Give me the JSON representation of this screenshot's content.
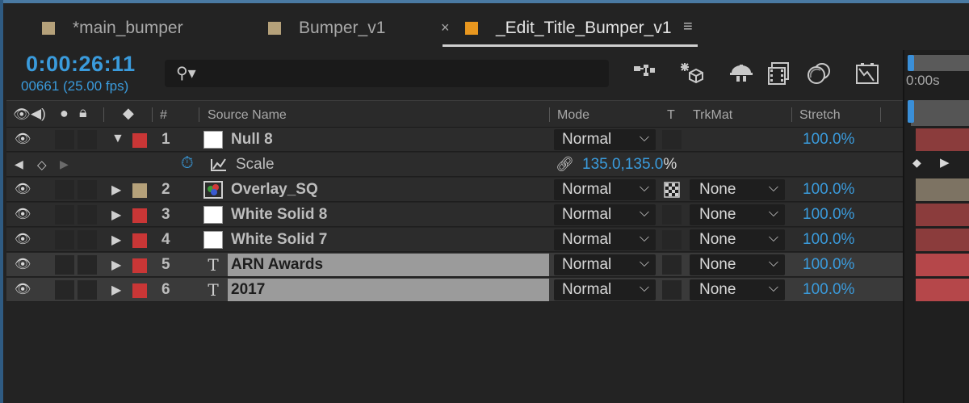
{
  "tabs": [
    {
      "label": "*main_bumper",
      "color": "#b5a17a",
      "active": false
    },
    {
      "label": "Bumper_v1",
      "color": "#b5a17a",
      "active": false
    },
    {
      "label": "_Edit_Title_Bumper_v1",
      "color": "#e8971f",
      "active": true
    }
  ],
  "header": {
    "timecode": "0:00:26:11",
    "frames": "00661 (25.00 fps)",
    "search_value": "",
    "search_placeholder": ""
  },
  "columns": {
    "number": "#",
    "source_name": "Source Name",
    "mode": "Mode",
    "t": "T",
    "trkmat": "TrkMat",
    "stretch": "Stretch"
  },
  "timeline": {
    "ruler_label": "0:00s"
  },
  "layers": [
    {
      "num": "1",
      "name": "Null 8",
      "label_color": "#c93636",
      "source": "white",
      "expanded": true,
      "mode": "Normal",
      "trkmat": "",
      "stretch": "100.0%",
      "selected": false,
      "bar_color": "#8b3c3c"
    },
    {
      "num": "2",
      "name": "Overlay_SQ",
      "label_color": "#b5a17a",
      "source": "footage",
      "expanded": false,
      "mode": "Normal",
      "trkmat": "None",
      "stretch": "100.0%",
      "selected": false,
      "bar_color": "#7d7363"
    },
    {
      "num": "3",
      "name": "White Solid 8",
      "label_color": "#c93636",
      "source": "white",
      "expanded": false,
      "mode": "Normal",
      "trkmat": "None",
      "stretch": "100.0%",
      "selected": false,
      "bar_color": "#8b3c3c"
    },
    {
      "num": "4",
      "name": "White Solid 7",
      "label_color": "#c93636",
      "source": "white",
      "expanded": false,
      "mode": "Normal",
      "trkmat": "None",
      "stretch": "100.0%",
      "selected": false,
      "bar_color": "#8b3c3c"
    },
    {
      "num": "5",
      "name": "ARN Awards",
      "label_color": "#c93636",
      "source": "text",
      "expanded": false,
      "mode": "Normal",
      "trkmat": "None",
      "stretch": "100.0%",
      "selected": true,
      "bar_color": "#b5474a"
    },
    {
      "num": "6",
      "name": "2017",
      "label_color": "#c93636",
      "source": "text",
      "expanded": false,
      "mode": "Normal",
      "trkmat": "None",
      "stretch": "100.0%",
      "selected": true,
      "bar_color": "#b5474a"
    }
  ],
  "property": {
    "name": "Scale",
    "value": "135.0,135.0",
    "unit": "%"
  }
}
